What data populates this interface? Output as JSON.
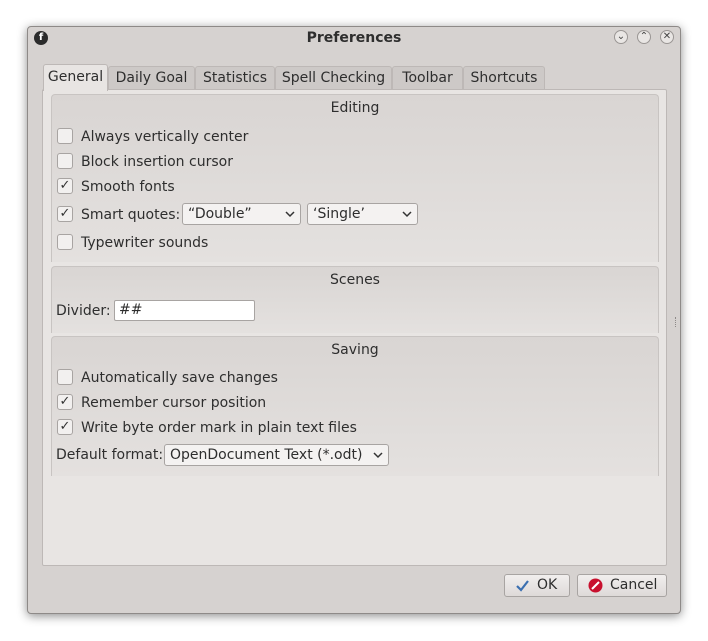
{
  "window": {
    "title": "Preferences",
    "app_icon_glyph": "f"
  },
  "tabs": [
    {
      "label": "General",
      "active": true
    },
    {
      "label": "Daily Goal",
      "active": false
    },
    {
      "label": "Statistics",
      "active": false
    },
    {
      "label": "Spell Checking",
      "active": false
    },
    {
      "label": "Toolbar",
      "active": false
    },
    {
      "label": "Shortcuts",
      "active": false
    }
  ],
  "editing": {
    "title": "Editing",
    "always_vertically_center": {
      "label": "Always vertically center",
      "checked": false
    },
    "block_insertion_cursor": {
      "label": "Block insertion cursor",
      "checked": false
    },
    "smooth_fonts": {
      "label": "Smooth fonts",
      "checked": true
    },
    "smart_quotes": {
      "label": "Smart quotes:",
      "checked": true,
      "double_value": "“Double”",
      "single_value": "‘Single’"
    },
    "typewriter_sounds": {
      "label": "Typewriter sounds",
      "checked": false
    }
  },
  "scenes": {
    "title": "Scenes",
    "divider_label": "Divider:",
    "divider_value": "##"
  },
  "saving": {
    "title": "Saving",
    "auto_save": {
      "label": "Automatically save changes",
      "checked": false
    },
    "remember_cursor": {
      "label": "Remember cursor position",
      "checked": true
    },
    "write_bom": {
      "label": "Write byte order mark in plain text files",
      "checked": true
    },
    "default_format_label": "Default format:",
    "default_format_value": "OpenDocument Text (*.odt)"
  },
  "buttons": {
    "ok": "OK",
    "cancel": "Cancel"
  },
  "glyphs": {
    "check": "✓",
    "combo_arrow": "⌄",
    "minimize": "⌄",
    "maximize": "⌃",
    "close": "✕"
  },
  "colors": {
    "window_bg": "#d6d2d0",
    "pane_bg": "#e8e5e3",
    "ok_icon": "#3b6fb0",
    "cancel_icon": "#c8102e"
  }
}
